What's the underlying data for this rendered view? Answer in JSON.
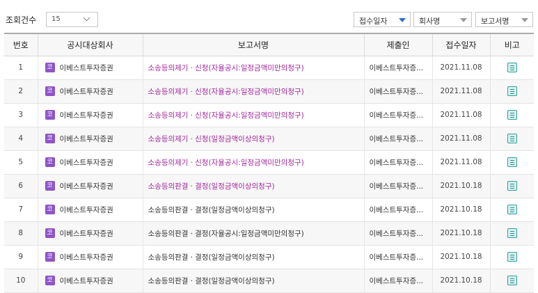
{
  "toolbar": {
    "count_label": "조회건수",
    "page_size": "15",
    "sort_options": [
      "접수일자",
      "회사명",
      "보고서명"
    ]
  },
  "table": {
    "headers": [
      "번호",
      "공시대상회사",
      "보고서명",
      "제출인",
      "접수일자",
      "비고"
    ],
    "rows": [
      {
        "no": "1",
        "badge": "코",
        "company": "이베스트투자증권",
        "report": "소송등의제기ㆍ신청(자율공시:일정금액미만의청구)",
        "submitter": "이베스트투자증...",
        "date": "2021.11.08"
      },
      {
        "no": "2",
        "badge": "코",
        "company": "이베스트투자증권",
        "report": "소송등의제기ㆍ신청(자율공시:일정금액미만의청구)",
        "submitter": "이베스트투자증...",
        "date": "2021.11.08"
      },
      {
        "no": "3",
        "badge": "코",
        "company": "이베스트투자증권",
        "report": "소송등의제기ㆍ신청(자율공시:일정금액미만의청구)",
        "submitter": "이베스트투자증...",
        "date": "2021.11.08"
      },
      {
        "no": "4",
        "badge": "코",
        "company": "이베스트투자증권",
        "report": "소송등의제기ㆍ신청(일정금액이상의청구)",
        "submitter": "이베스트투자증...",
        "date": "2021.11.08"
      },
      {
        "no": "5",
        "badge": "코",
        "company": "이베스트투자증권",
        "report": "소송등의제기ㆍ신청(자율공시:일정금액미만의청구)",
        "submitter": "이베스트투자증...",
        "date": "2021.11.08"
      },
      {
        "no": "6",
        "badge": "코",
        "company": "이베스트투자증권",
        "report": "소송등의판결ㆍ결정(일정금액이상의청구)",
        "submitter": "이베스트투자증...",
        "date": "2021.10.18"
      },
      {
        "no": "7",
        "badge": "코",
        "company": "이베스트투자증권",
        "report": "소송등의판결ㆍ결정(일정금액이상의청구)",
        "submitter": "이베스트투자증...",
        "date": "2021.10.18"
      },
      {
        "no": "8",
        "badge": "코",
        "company": "이베스트투자증권",
        "report": "소송등의판결ㆍ결정(자율공시:일정금액미만의청구)",
        "submitter": "이베스트투자증...",
        "date": "2021.10.18"
      },
      {
        "no": "9",
        "badge": "코",
        "company": "이베스트투자증권",
        "report": "소송등의판결ㆍ결정(일정금액이상의청구)",
        "submitter": "이베스트투자증...",
        "date": "2021.10.18"
      },
      {
        "no": "10",
        "badge": "코",
        "company": "이베스트투자증권",
        "report": "소송등의판결ㆍ결정(일정금액이상의청구)",
        "submitter": "이베스트투자증...",
        "date": "2021.10.18"
      }
    ]
  },
  "colors": {
    "badge": "#8e54c9",
    "report_link": "#a3279c",
    "sort_active": "#2a6fd1",
    "note_icon": "#2f9f9a"
  },
  "icons": {
    "badge": "kosdaq-badge-icon",
    "note": "document-icon",
    "sort": "sort-triangle-icon",
    "dropdown": "chevron-down-icon"
  }
}
